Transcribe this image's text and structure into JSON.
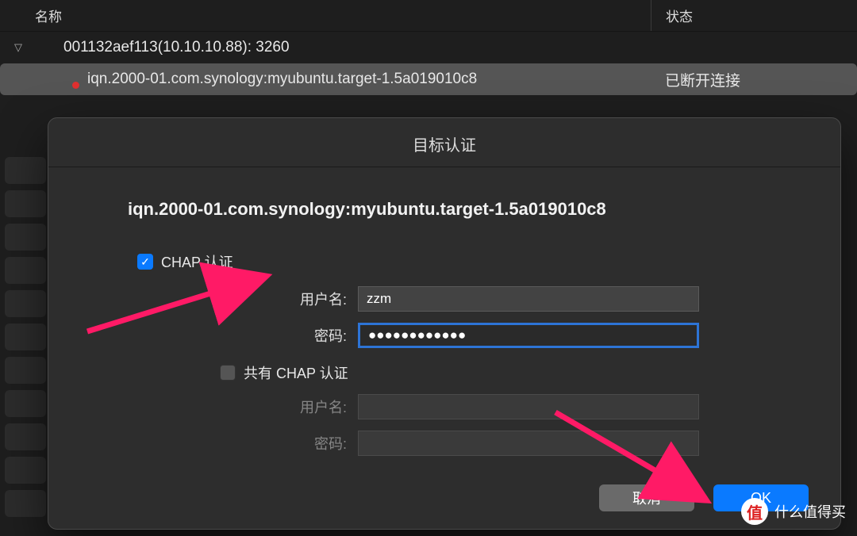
{
  "table": {
    "col_name": "名称",
    "col_status": "状态"
  },
  "tree": {
    "parent": "001132aef113(10.10.10.88): 3260",
    "child": "iqn.2000-01.com.synology:myubuntu.target-1.5a019010c8",
    "child_status": "已断开连接"
  },
  "dialog": {
    "title": "目标认证",
    "iqn": "iqn.2000-01.com.synology:myubuntu.target-1.5a019010c8",
    "chap_label": "CHAP 认证",
    "username_label": "用户名:",
    "username_value": "zzm",
    "password_label": "密码:",
    "password_value": "●●●●●●●●●●●●",
    "mutual_label": "共有 CHAP 认证",
    "mutual_username_label": "用户名:",
    "mutual_password_label": "密码:",
    "cancel": "取消",
    "ok": "OK"
  },
  "watermark": {
    "badge": "值",
    "text": "什么值得买"
  }
}
